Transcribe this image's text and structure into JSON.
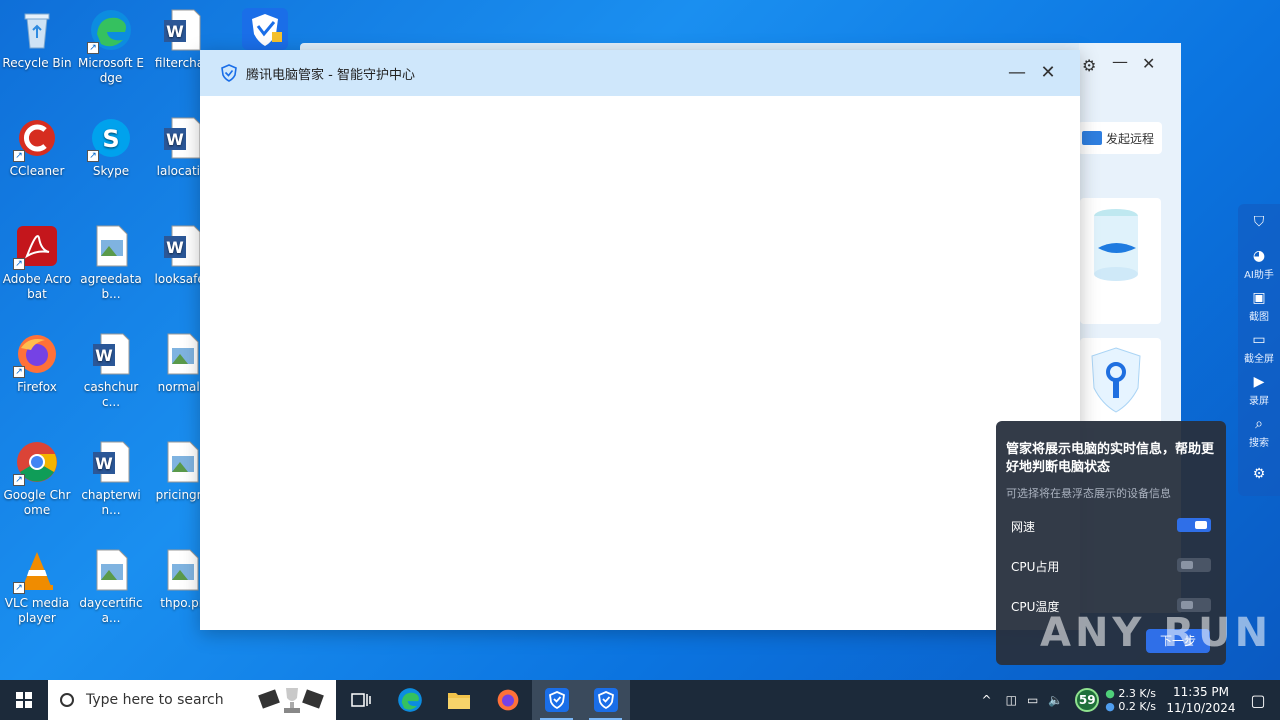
{
  "desktop": {
    "icons": [
      {
        "label": "Recycle Bin"
      },
      {
        "label": "Microsoft Edge"
      },
      {
        "label": "filterchar"
      },
      {
        "label": "CCleaner"
      },
      {
        "label": "Skype"
      },
      {
        "label": "lalocatio"
      },
      {
        "label": "Adobe Acrobat"
      },
      {
        "label": "agreedatab..."
      },
      {
        "label": "looksafet"
      },
      {
        "label": "Firefox"
      },
      {
        "label": "cashchurc..."
      },
      {
        "label": "normalc"
      },
      {
        "label": "Google Chrome"
      },
      {
        "label": "chapterwin..."
      },
      {
        "label": "pricingm"
      },
      {
        "label": "VLC media player"
      },
      {
        "label": "daycertifica..."
      },
      {
        "label": "thpo.pr"
      }
    ]
  },
  "bg_window": {
    "remote_label": "发起远程"
  },
  "dialog": {
    "title": "腾讯电脑管家 - 智能守护中心"
  },
  "sidebar": {
    "items": [
      {
        "label": ""
      },
      {
        "label": "AI助手"
      },
      {
        "label": "截图"
      },
      {
        "label": "截全屏"
      },
      {
        "label": "录屏"
      },
      {
        "label": "搜索"
      }
    ]
  },
  "panel": {
    "title": "管家将展示电脑的实时信息，帮助更好地判断电脑状态",
    "subtitle": "可选择将在悬浮态展示的设备信息",
    "rows": [
      {
        "label": "网速",
        "on": true
      },
      {
        "label": "CPU占用",
        "on": false
      },
      {
        "label": "CPU温度",
        "on": false
      }
    ],
    "next_label": "下一步"
  },
  "watermark": "ANY RUN",
  "taskbar": {
    "search_placeholder": "Type here to search",
    "badge": "59",
    "net_up": "2.3 K/s",
    "net_down": "0.2 K/s",
    "time": "11:35 PM",
    "date": "11/10/2024"
  },
  "colors": {
    "accent": "#2f6fe8",
    "dialog_title_bg": "#cfe7fb",
    "taskbar_bg": "#1c2a3a"
  }
}
